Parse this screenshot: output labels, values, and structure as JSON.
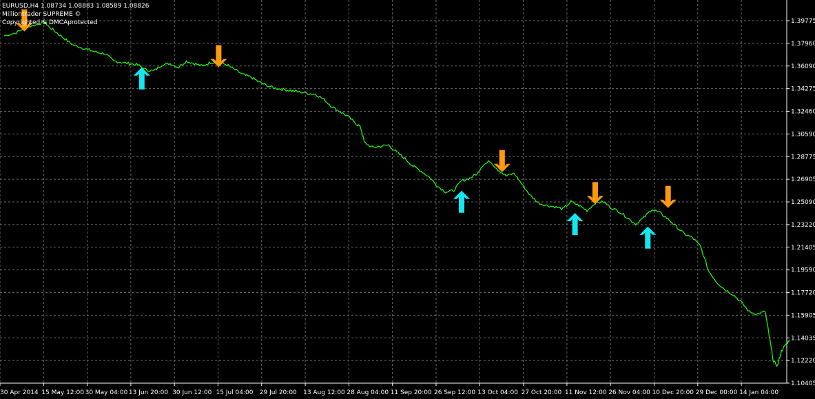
{
  "header": {
    "line1": "EURUSD,H4  1.08734 1.08883 1.08589 1.08826",
    "line2": "Milliontrader SUPREME ©",
    "line3": "Copyrighted & DMCAprotected"
  },
  "colors": {
    "background": "#000000",
    "grid": "#6b6b6b",
    "price": "#22ee11",
    "buy_arrow": "#11e8f0",
    "sell_arrow": "#ff9a0e",
    "text": "#ffffff"
  },
  "chart_data": {
    "type": "line",
    "symbol": "EURUSD",
    "timeframe": "H4",
    "ohlc": {
      "open": 1.08734,
      "high": 1.08883,
      "low": 1.08589,
      "close": 1.08826
    },
    "y_ticks": [
      "1.39775",
      "1.37960",
      "1.36090",
      "1.34275",
      "1.32460",
      "1.30590",
      "1.28775",
      "1.26905",
      "1.25090",
      "1.23220",
      "1.21405",
      "1.19590",
      "1.17720",
      "1.15905",
      "1.14035",
      "1.12220",
      "1.10405"
    ],
    "ylim": [
      1.10405,
      1.39775
    ],
    "x_ticks": [
      "30 Apr 2014",
      "15 May 12:00",
      "30 May 04:00",
      "13 Jun 20:00",
      "30 Jun 12:00",
      "15 Jul 04:00",
      "29 Jul 20:00",
      "13 Aug 12:00",
      "28 Aug 04:00",
      "11 Sep 20:00",
      "26 Sep 12:00",
      "13 Oct 04:00",
      "27 Oct 20:00",
      "11 Nov 12:00",
      "26 Nov 04:00",
      "10 Dec 20:00",
      "29 Dec 00:00",
      "14 Jan 04:00"
    ],
    "series": [
      {
        "points": [
          [
            0,
            1.3855
          ],
          [
            3,
            1.388
          ],
          [
            5,
            1.392
          ],
          [
            8,
            1.3945
          ],
          [
            10,
            1.397
          ],
          [
            11,
            1.393
          ],
          [
            13,
            1.388
          ],
          [
            15,
            1.383
          ],
          [
            17,
            1.378
          ],
          [
            19,
            1.376
          ],
          [
            21,
            1.374
          ],
          [
            23,
            1.372
          ],
          [
            25,
            1.371
          ],
          [
            27,
            1.365
          ],
          [
            29,
            1.364
          ],
          [
            31,
            1.363
          ],
          [
            33,
            1.362
          ],
          [
            35,
            1.358
          ],
          [
            37,
            1.357
          ],
          [
            39,
            1.362
          ],
          [
            41,
            1.363
          ],
          [
            43,
            1.36
          ],
          [
            45,
            1.365
          ],
          [
            47,
            1.363
          ],
          [
            49,
            1.361
          ],
          [
            51,
            1.364
          ],
          [
            53,
            1.364
          ],
          [
            55,
            1.362
          ],
          [
            57,
            1.358
          ],
          [
            59,
            1.354
          ],
          [
            61,
            1.352
          ],
          [
            63,
            1.348
          ],
          [
            65,
            1.345
          ],
          [
            67,
            1.343
          ],
          [
            69,
            1.342
          ],
          [
            71,
            1.341
          ],
          [
            73,
            1.34
          ],
          [
            75,
            1.339
          ],
          [
            77,
            1.338
          ],
          [
            79,
            1.334
          ],
          [
            81,
            1.328
          ],
          [
            83,
            1.324
          ],
          [
            85,
            1.32
          ],
          [
            87,
            1.314
          ],
          [
            88,
            1.312
          ],
          [
            89,
            1.299
          ],
          [
            91,
            1.295
          ],
          [
            93,
            1.296
          ],
          [
            95,
            1.297
          ],
          [
            97,
            1.291
          ],
          [
            99,
            1.286
          ],
          [
            101,
            1.28
          ],
          [
            103,
            1.276
          ],
          [
            105,
            1.271
          ],
          [
            107,
            1.264
          ],
          [
            109,
            1.259
          ],
          [
            111,
            1.26
          ],
          [
            113,
            1.268
          ],
          [
            115,
            1.27
          ],
          [
            117,
            1.274
          ],
          [
            118,
            1.28
          ],
          [
            120,
            1.284
          ],
          [
            122,
            1.277
          ],
          [
            124,
            1.272
          ],
          [
            126,
            1.274
          ],
          [
            128,
            1.265
          ],
          [
            130,
            1.256
          ],
          [
            132,
            1.25
          ],
          [
            134,
            1.248
          ],
          [
            136,
            1.247
          ],
          [
            138,
            1.245
          ],
          [
            140,
            1.251
          ],
          [
            142,
            1.248
          ],
          [
            144,
            1.244
          ],
          [
            146,
            1.25
          ],
          [
            148,
            1.251
          ],
          [
            150,
            1.246
          ],
          [
            152,
            1.243
          ],
          [
            154,
            1.238
          ],
          [
            156,
            1.233
          ],
          [
            158,
            1.238
          ],
          [
            160,
            1.245
          ],
          [
            162,
            1.242
          ],
          [
            164,
            1.237
          ],
          [
            166,
            1.231
          ],
          [
            168,
            1.225
          ],
          [
            170,
            1.222
          ],
          [
            172,
            1.215
          ],
          [
            174,
            1.195
          ],
          [
            176,
            1.186
          ],
          [
            178,
            1.18
          ],
          [
            180,
            1.176
          ],
          [
            182,
            1.17
          ],
          [
            184,
            1.162
          ],
          [
            186,
            1.16
          ],
          [
            188,
            1.162
          ],
          [
            189,
            1.142
          ],
          [
            190,
            1.122
          ],
          [
            191,
            1.118
          ],
          [
            192,
            1.13
          ],
          [
            193,
            1.135
          ],
          [
            194,
            1.139
          ]
        ]
      }
    ],
    "x_range": [
      0,
      194
    ],
    "signals": [
      {
        "type": "sell",
        "x": 5,
        "price": 1.398
      },
      {
        "type": "buy",
        "x": 34,
        "price": 1.351
      },
      {
        "type": "sell",
        "x": 53,
        "price": 1.369
      },
      {
        "type": "buy",
        "x": 113,
        "price": 1.251
      },
      {
        "type": "sell",
        "x": 123,
        "price": 1.284
      },
      {
        "type": "buy",
        "x": 141,
        "price": 1.233
      },
      {
        "type": "sell",
        "x": 146,
        "price": 1.258
      },
      {
        "type": "buy",
        "x": 159,
        "price": 1.222
      },
      {
        "type": "sell",
        "x": 164,
        "price": 1.255
      }
    ],
    "grid": true
  }
}
